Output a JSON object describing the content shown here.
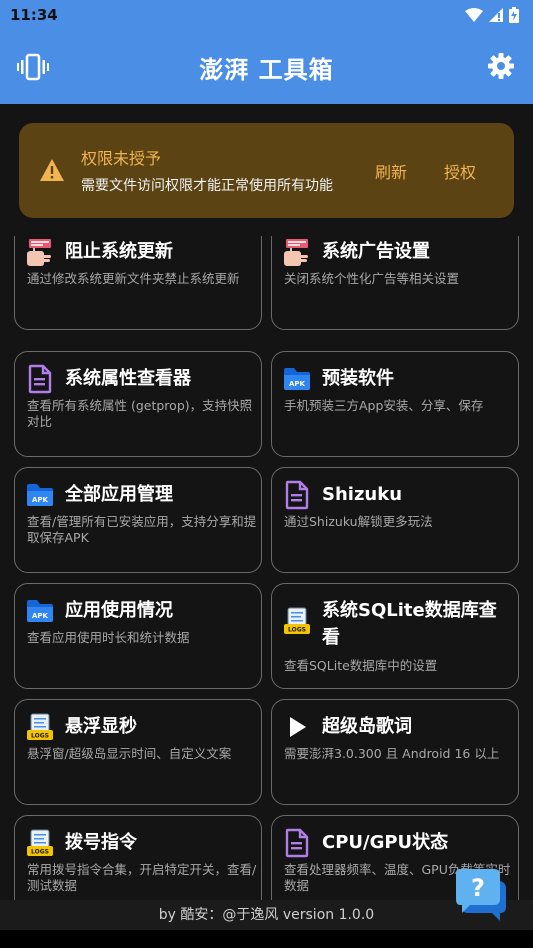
{
  "status_bar": {
    "time": "11:34"
  },
  "app_bar": {
    "title": "澎湃 工具箱"
  },
  "warning": {
    "title": "权限未授予",
    "message": "需要文件访问权限才能正常使用所有功能",
    "refresh_label": "刷新",
    "grant_label": "授权"
  },
  "tools": [
    {
      "title": "阻止系统更新",
      "desc": "通过修改系统更新文件夹禁止系统更新",
      "icon": "stop-sign-icon"
    },
    {
      "title": "系统广告设置",
      "desc": "关闭系统个性化广告等相关设置",
      "icon": "stop-sign-icon"
    },
    {
      "title": "系统属性查看器",
      "desc": "查看所有系统属性 (getprop)，支持快照对比",
      "icon": "document-icon"
    },
    {
      "title": "预装软件",
      "desc": "手机预装三方App安装、分享、保存",
      "icon": "apk-folder-icon",
      "badge": "APK"
    },
    {
      "title": "全部应用管理",
      "desc": "查看/管理所有已安装应用，支持分享和提取保存APK",
      "icon": "apk-folder-icon",
      "badge": "APK"
    },
    {
      "title": "Shizuku",
      "desc": "通过Shizuku解锁更多玩法",
      "icon": "document-icon"
    },
    {
      "title": "应用使用情况",
      "desc": "查看应用使用时长和统计数据",
      "icon": "apk-folder-icon",
      "badge": "APK"
    },
    {
      "title": "系统SQLite数据库查看",
      "desc": "查看SQLite数据库中的设置",
      "icon": "logs-icon",
      "badge": "LOGS"
    },
    {
      "title": "悬浮显秒",
      "desc": "悬浮窗/超级岛显示时间、自定义文案",
      "icon": "logs-icon",
      "badge": "LOGS"
    },
    {
      "title": "超级岛歌词",
      "desc": "需要澎湃3.0.300 且 Android 16 以上",
      "icon": "play-icon"
    },
    {
      "title": "拨号指令",
      "desc": "常用拨号指令合集，开启特定开关，查看/测试数据",
      "icon": "logs-icon",
      "badge": "LOGS"
    },
    {
      "title": "CPU/GPU状态",
      "desc": "查看处理器频率、温度、GPU负载等实时数据",
      "icon": "document-icon"
    }
  ],
  "footer": {
    "text": "by 酷安：@于逸风 version 1.0.0"
  },
  "colors": {
    "primary": "#4a8ee6",
    "warning_bg": "#5b4314",
    "warning_accent": "#f1b450",
    "background": "#141414"
  }
}
